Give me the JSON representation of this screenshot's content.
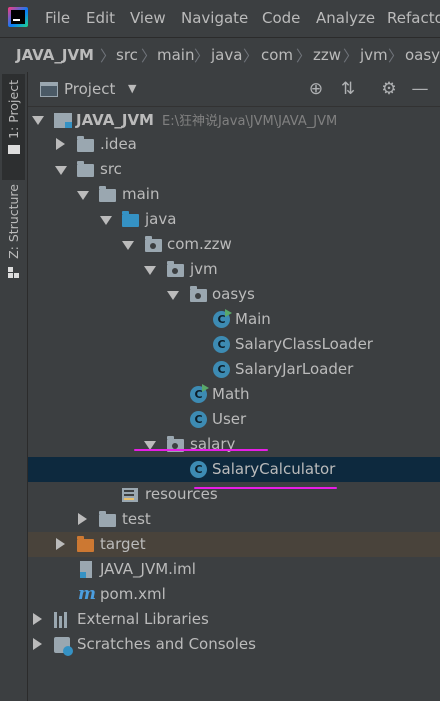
{
  "menu": [
    "File",
    "Edit",
    "View",
    "Navigate",
    "Code",
    "Analyze",
    "Refactor"
  ],
  "breadcrumbs": [
    "JAVA_JVM",
    "src",
    "main",
    "java",
    "com",
    "zzw",
    "jvm",
    "oasys"
  ],
  "stripe": {
    "project": "1: Project",
    "structure": "Z: Structure"
  },
  "tool_window": {
    "title": "Project"
  },
  "tree": {
    "root": {
      "label": "JAVA_JVM",
      "path": "E:\\狂神说Java\\JVM\\JAVA_JVM"
    },
    "idea": ".idea",
    "src": "src",
    "main": "main",
    "java": "java",
    "package": "com.zzw",
    "jvm": "jvm",
    "oasys": "oasys",
    "main_class": "Main",
    "salary_class_loader": "SalaryClassLoader",
    "salary_jar_loader": "SalaryJarLoader",
    "math": "Math",
    "user": "User",
    "salary": "salary",
    "salary_calculator": "SalaryCalculator",
    "resources": "resources",
    "test": "test",
    "target": "target",
    "iml": "JAVA_JVM.iml",
    "pom": "pom.xml",
    "external_libraries": "External Libraries",
    "scratches": "Scratches and Consoles"
  },
  "icons": {
    "class_letter": "C",
    "maven_letter": "m"
  },
  "colors": {
    "background": "#3c3f41",
    "selection": "#0d293e",
    "excluded_highlight": "#49433b",
    "annotation": "#e61ee6",
    "folder_blue": "#3592c4",
    "folder_orange": "#cc7832"
  }
}
